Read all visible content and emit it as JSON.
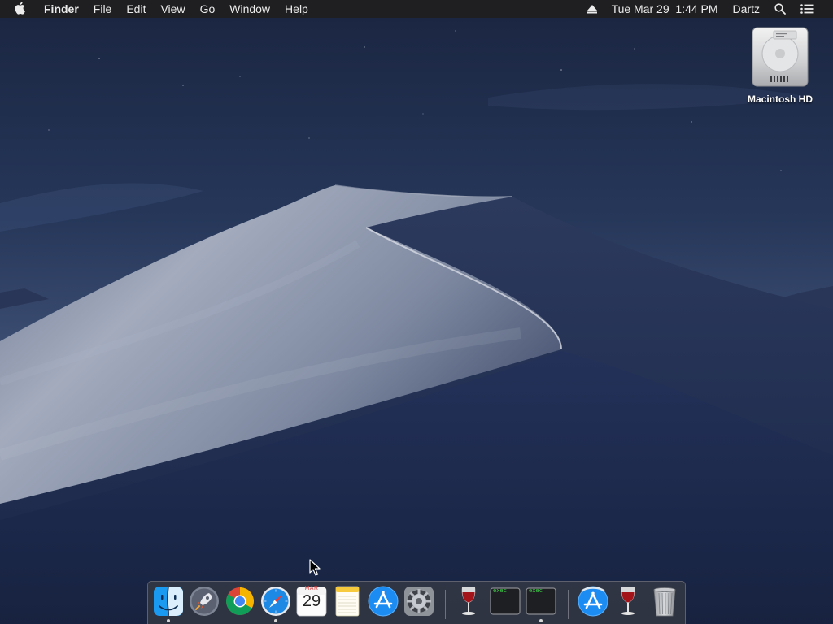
{
  "menubar": {
    "apple_icon": "apple-logo-icon",
    "app_name": "Finder",
    "menus": [
      "File",
      "Edit",
      "View",
      "Go",
      "Window",
      "Help"
    ],
    "status": {
      "eject_icon": "eject-icon",
      "datetime": "Tue Mar 29  1:44 PM",
      "user": "Dartz",
      "spotlight_icon": "spotlight-search-icon",
      "notification_icon": "notification-center-icon"
    }
  },
  "desktop": {
    "icons": [
      {
        "label": "Macintosh HD",
        "icon": "hard-drive-icon"
      }
    ]
  },
  "dock": {
    "apps": [
      {
        "name": "Finder",
        "icon": "finder-icon",
        "running": true
      },
      {
        "name": "Launchpad",
        "icon": "launchpad-icon",
        "running": false
      },
      {
        "name": "Google Chrome",
        "icon": "chrome-icon",
        "running": false
      },
      {
        "name": "Safari",
        "icon": "safari-icon",
        "running": true
      },
      {
        "name": "Calendar",
        "icon": "calendar-icon",
        "running": false,
        "month": "MAR",
        "day": "29"
      },
      {
        "name": "Notes",
        "icon": "notes-icon",
        "running": false
      },
      {
        "name": "App Store",
        "icon": "app-store-icon",
        "running": false
      },
      {
        "name": "System Preferences",
        "icon": "system-preferences-icon",
        "running": false
      }
    ],
    "recent": [
      {
        "name": "Wine",
        "icon": "wine-glass-icon",
        "running": false
      },
      {
        "name": "exec",
        "icon": "terminal-exec-icon",
        "label": "exec",
        "running": false
      },
      {
        "name": "exec",
        "icon": "terminal-exec-icon",
        "label": "exec",
        "running": true
      }
    ],
    "others": [
      {
        "name": "App Store",
        "icon": "app-store-icon",
        "running": false
      },
      {
        "name": "Wine",
        "icon": "wine-glass-icon",
        "running": false
      },
      {
        "name": "Trash",
        "icon": "trash-icon",
        "running": false
      }
    ]
  },
  "colors": {
    "menubar_bg": "#1f1f22",
    "sky_top": "#1b2744",
    "sky_horizon": "#3b4c6e",
    "dune_light": "#9aa3b5",
    "dune_dark": "#1d2a4c"
  }
}
